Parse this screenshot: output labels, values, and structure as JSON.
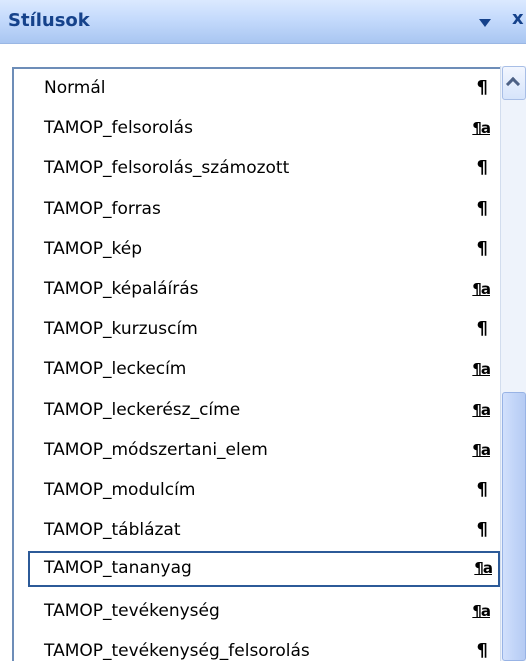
{
  "pane": {
    "title": "Stílusok",
    "dropdown_icon": "dropdown-arrow-icon",
    "close_label": "x"
  },
  "styles": [
    {
      "label": "Normál",
      "icon": "¶",
      "icon_type": "paragraph-mark-icon"
    },
    {
      "label": "TAMOP_felsorolás",
      "icon": "¶a",
      "icon_type": "linked-style-icon"
    },
    {
      "label": "TAMOP_felsorolás_számozott",
      "icon": "¶",
      "icon_type": "paragraph-mark-icon"
    },
    {
      "label": "TAMOP_forras",
      "icon": "¶",
      "icon_type": "paragraph-mark-icon"
    },
    {
      "label": "TAMOP_kép",
      "icon": "¶",
      "icon_type": "paragraph-mark-icon"
    },
    {
      "label": "TAMOP_képaláírás",
      "icon": "¶a",
      "icon_type": "linked-style-icon"
    },
    {
      "label": "TAMOP_kurzuscím",
      "icon": "¶",
      "icon_type": "paragraph-mark-icon"
    },
    {
      "label": "TAMOP_leckecím",
      "icon": "¶a",
      "icon_type": "linked-style-icon"
    },
    {
      "label": "TAMOP_leckerész_címe",
      "icon": "¶a",
      "icon_type": "linked-style-icon"
    },
    {
      "label": "TAMOP_módszertani_elem",
      "icon": "¶a",
      "icon_type": "linked-style-icon"
    },
    {
      "label": "TAMOP_modulcím",
      "icon": "¶",
      "icon_type": "paragraph-mark-icon"
    },
    {
      "label": "TAMOP_táblázat",
      "icon": "¶",
      "icon_type": "paragraph-mark-icon"
    },
    {
      "label": "TAMOP_tananyag",
      "icon": "¶a",
      "icon_type": "linked-style-icon",
      "selected": true
    },
    {
      "label": "TAMOP_tevékenység",
      "icon": "¶a",
      "icon_type": "linked-style-icon"
    },
    {
      "label": "TAMOP_tevékenység_felsorolás",
      "icon": "¶",
      "icon_type": "paragraph-mark-icon"
    }
  ],
  "colors": {
    "title_text": "#15428b",
    "titlebar_bg": "#c4dafc",
    "selection_border": "#2c5a98",
    "scrollbar_thumb": "#c2d5f8"
  }
}
